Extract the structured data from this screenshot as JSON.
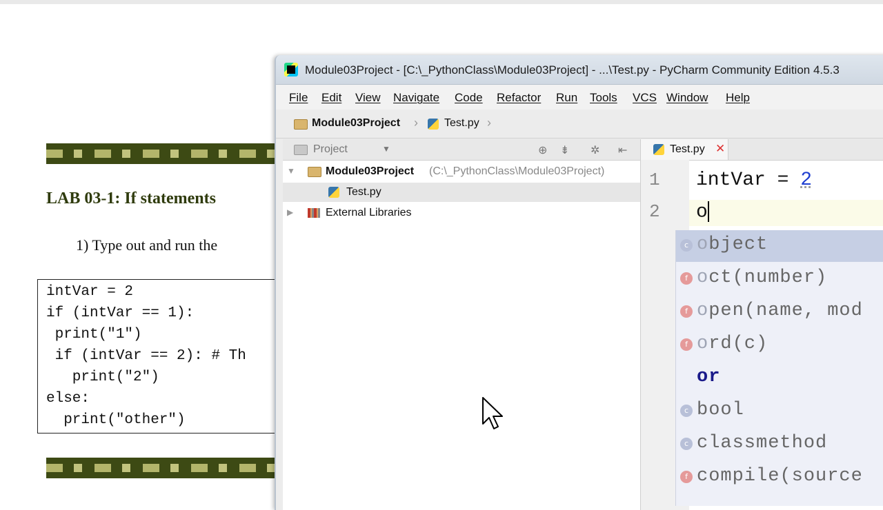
{
  "document": {
    "heading": "LAB 03-1: If statements",
    "step": "1)  Type out and run the",
    "code_lines": [
      "intVar = 2",
      "if (intVar == 1):",
      " print(\"1\")",
      " if (intVar == 2): # Th",
      "   print(\"2\")",
      "else:",
      "  print(\"other\")"
    ]
  },
  "window": {
    "title": "Module03Project - [C:\\_PythonClass\\Module03Project] - ...\\Test.py - PyCharm Community Edition 4.5.3"
  },
  "menu": [
    "File",
    "Edit",
    "View",
    "Navigate",
    "Code",
    "Refactor",
    "Run",
    "Tools",
    "VCS",
    "Window",
    "Help"
  ],
  "navbar": {
    "project": "Module03Project",
    "file": "Test.py"
  },
  "project_panel": {
    "label": "Project",
    "root_name": "Module03Project",
    "root_path": "(C:\\_PythonClass\\Module03Project)",
    "file": "Test.py",
    "external": "External Libraries"
  },
  "editor": {
    "tab": "Test.py",
    "lines": [
      {
        "num": "1",
        "code_prefix": "intVar = ",
        "code_value": "2"
      },
      {
        "num": "2",
        "code_prefix": "o"
      }
    ]
  },
  "completion": [
    {
      "kind": "class",
      "icon": "c",
      "match": "o",
      "text": "bject"
    },
    {
      "kind": "func",
      "icon": "f",
      "match": "o",
      "text": "ct(number)"
    },
    {
      "kind": "func",
      "icon": "f",
      "match": "o",
      "text": "pen(name, mod"
    },
    {
      "kind": "func",
      "icon": "f",
      "match": "o",
      "text": "rd(c)"
    },
    {
      "kind": "keyword",
      "icon": "",
      "match": "",
      "text": "or"
    },
    {
      "kind": "class",
      "icon": "c",
      "match": "",
      "text": "bool"
    },
    {
      "kind": "class",
      "icon": "c",
      "match": "",
      "text": "classmethod"
    },
    {
      "kind": "func",
      "icon": "f",
      "match": "",
      "text": "compile(source"
    }
  ],
  "colors": {
    "title_bar": "#d6dee7",
    "selection": "#c6cfe4",
    "accent_number": "#1f3fd0",
    "doc_banner": "#3d4a14"
  }
}
